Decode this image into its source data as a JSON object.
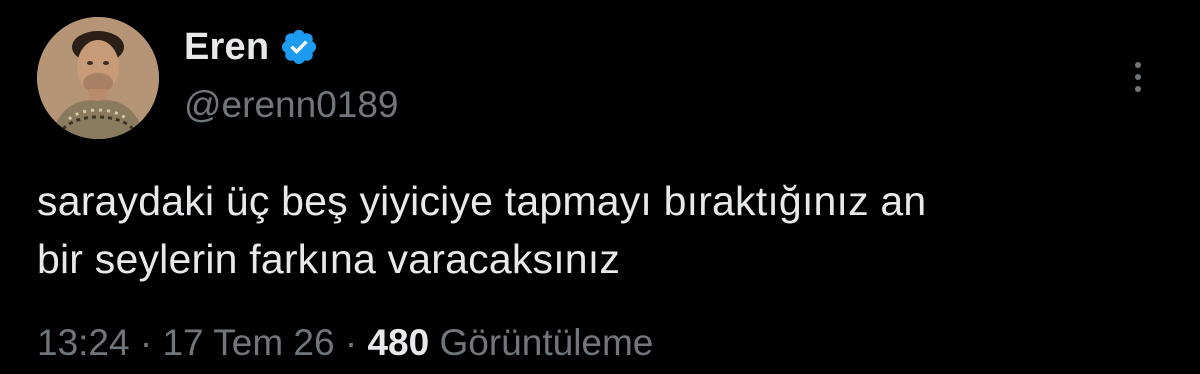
{
  "tweet": {
    "display_name": "Eren",
    "handle": "@erenn0189",
    "verified_icon": "verified-badge-icon",
    "text_lines": [
      "saraydaki üç beş yiyiciye tapmayı bıraktığınız an",
      "bir seylerin farkına varacaksınız"
    ],
    "time": "13:24",
    "separator": "·",
    "date": "17 Tem 26",
    "views_count": "480",
    "views_label": "Görüntüleme",
    "more_icon": "more-vertical-icon"
  },
  "colors": {
    "background": "#000000",
    "primary_text": "#e7e9ea",
    "secondary_text": "#71767b",
    "verified_blue": "#1d9bf0"
  }
}
